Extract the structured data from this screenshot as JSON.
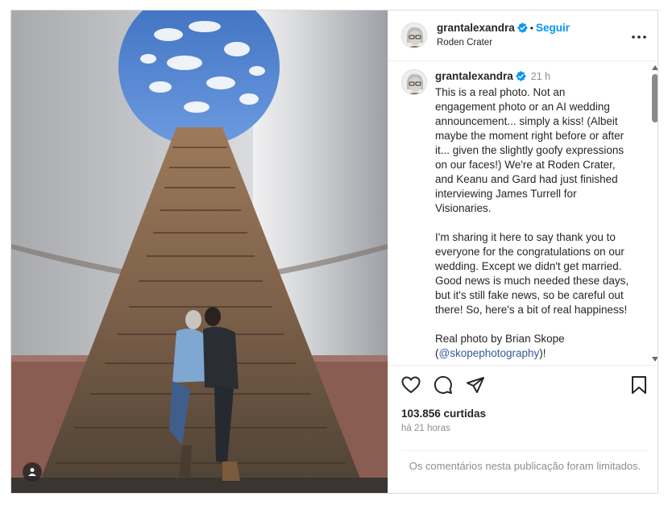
{
  "post": {
    "username": "grantalexandra",
    "follow_label": "Seguir",
    "separator": "•",
    "location": "Roden Crater",
    "caption_time": "21 h",
    "caption_lines_1": [
      "This is a real photo. Not an",
      "engagement photo or an AI wedding",
      "announcement... simply a kiss! (Albeit",
      "maybe the moment right before or after",
      "it... given the slightly goofy expressions",
      "on our faces!) We're at Roden Crater,",
      "and Keanu and Gard had just finished",
      "interviewing James Turrell for",
      "Visionaries."
    ],
    "caption_lines_2": [
      "I'm sharing it here to say thank you to",
      "everyone for the congratulations on our",
      "wedding. Except we didn't get married.",
      "Good news is much needed these days,",
      "but it's still fake news, so be careful out",
      "there! So, here's a bit of real happiness!"
    ],
    "credit_line": "Real photo by Brian Skope",
    "credit_open": "(",
    "credit_mention": "@skopephotography",
    "credit_close": ")!",
    "likes": "103.856 curtidas",
    "posted_ago": "há 21 horas",
    "comments_disabled": "Os comentários nesta publicação foram limitados."
  },
  "icons": {
    "verified": "verified-badge-icon",
    "more": "more-options-icon",
    "like": "heart-icon",
    "comment": "comment-icon",
    "share": "share-icon",
    "save": "bookmark-icon",
    "tags": "user-tag-icon"
  },
  "colors": {
    "accent": "#0095f6",
    "mention": "#385898",
    "muted": "#8e8e8e",
    "text": "#262626"
  }
}
